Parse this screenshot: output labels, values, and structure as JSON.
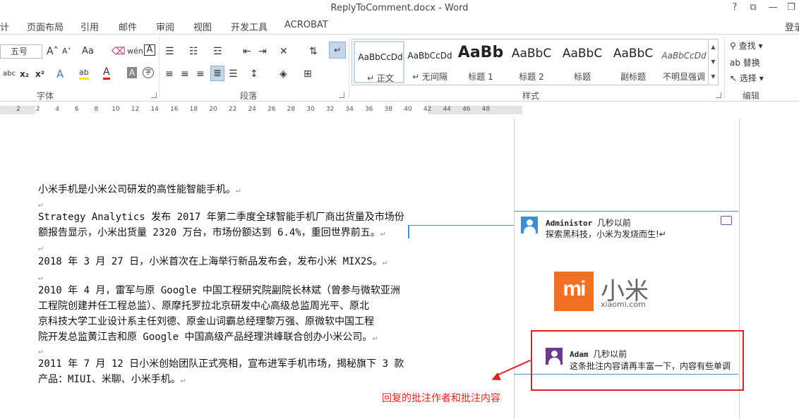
{
  "window": {
    "title": "ReplyToComment.docx - Word",
    "help": "?",
    "restore_ribbon": "⧉",
    "minimize": "—",
    "maximize": "❐",
    "signin": "登录"
  },
  "tabs": [
    "计",
    "页面布局",
    "引用",
    "邮件",
    "审阅",
    "视图",
    "开发工具",
    "ACROBAT"
  ],
  "ribbon": {
    "font_group_label": "字体",
    "paragraph_group_label": "段落",
    "styles_group_label": "样式",
    "editing_group_label": "编辑",
    "font_size": "五号",
    "grow_font": "A˄",
    "shrink_font": "A˅",
    "change_case": "Aa",
    "phonetic": "wén",
    "char_border": "A",
    "strike": "abc",
    "subscript": "x₂",
    "superscript": "x²",
    "text_effect": "A",
    "highlight": "ab",
    "font_color": "A",
    "char_shading": "A",
    "enclose": "字",
    "styles": [
      {
        "sample": "AaBbCcDd",
        "name": "↵ 正文",
        "selected": true
      },
      {
        "sample": "AaBbCcDd",
        "name": "↵ 无间隔",
        "selected": false
      },
      {
        "sample": "AaBb",
        "name": "标题 1",
        "selected": false
      },
      {
        "sample": "AaBbC",
        "name": "标题 2",
        "selected": false
      },
      {
        "sample": "AaBbC",
        "name": "标题",
        "selected": false
      },
      {
        "sample": "AaBbC",
        "name": "副标题",
        "selected": false
      },
      {
        "sample": "AaBbCcDd",
        "name": "不明显强调",
        "selected": false
      }
    ],
    "find": "查找",
    "replace": "替换",
    "select": "选择"
  },
  "ruler_ticks": [
    "2",
    "2",
    "4",
    "6",
    "8",
    "10",
    "12",
    "14",
    "16",
    "18",
    "20",
    "22",
    "24",
    "26",
    "28",
    "30",
    "32",
    "34",
    "36",
    "38",
    "40",
    "42",
    "44",
    "46",
    "48"
  ],
  "document": {
    "p1": "小米手机是小米公司研发的高性能智能手机。",
    "p2a": "Strategy Analytics 发布 2017 年第二季度全球智能手机厂商出货量及市场份",
    "p2b": "额报告显示，小米出货量 2320 万台，市场份额达到 6.4%，重回世界前五。",
    "p3": "2018 年 3 月 27 日，小米首次在上海举行新品发布会，发布小米 MIX2S。",
    "p4a": "2010 年 4 月，雷军与原 Google 中国工程研究院副院长林斌（曾参与微软亚洲",
    "p4b": "工程院创建并任工程总监）、原摩托罗拉北京研发中心高级总监周光平、原北",
    "p4c": "京科技大学工业设计系主任刘德、原金山词霸总经理黎万强、原微软中国工程",
    "p4d": "院开发总监黄江吉和原 Google 中国高级产品经理洪峰联合创办小米公司。",
    "p5a": "2011 年 7 月 12 日小米创始团队正式亮相，宣布进军手机市场，揭秘旗下 3 款",
    "p5b": "产品：MIUI、米聊、小米手机。",
    "para_mark": "↵"
  },
  "comments": [
    {
      "author": "Administor",
      "when": "几秒以前",
      "text": "探索黑科技，小米为发烧而生!↵",
      "avatar_color": "#3a8fd6"
    },
    {
      "author": "Adam",
      "when": "几秒以前",
      "text": "这条批注内容请再丰富一下，内容有些单调",
      "avatar_color": "#6b3a8c"
    }
  ],
  "logo": {
    "mi": "mi",
    "cn": "小米",
    "domain": "xiaomi.com"
  },
  "annotation": {
    "text": "回复的批注作者和批注内容",
    "color": "#e02020"
  }
}
